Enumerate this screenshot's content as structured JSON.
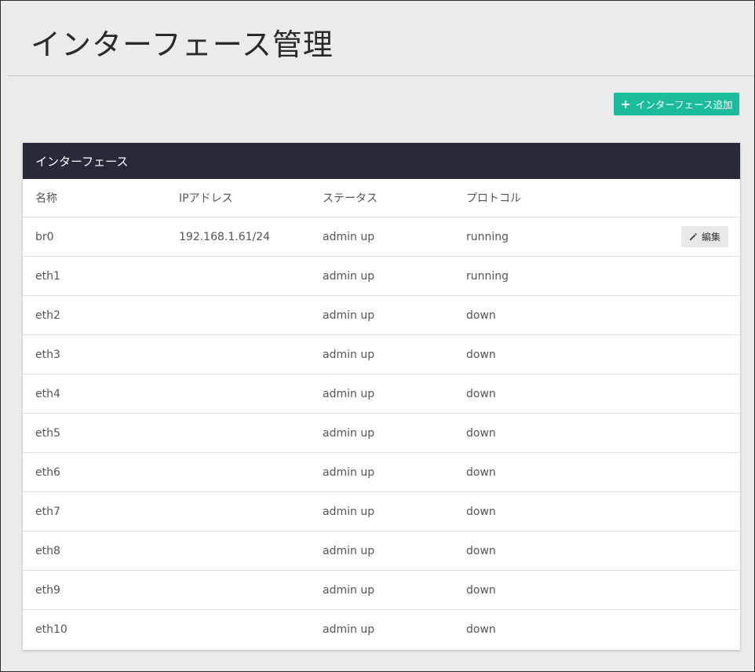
{
  "page": {
    "title": "インターフェース管理"
  },
  "toolbar": {
    "add_icon": "plus-icon",
    "add_label": "インターフェース追加"
  },
  "card": {
    "title": "インターフェース"
  },
  "table": {
    "columns": [
      "名称",
      "IPアドレス",
      "ステータス",
      "プロトコル"
    ],
    "edit_label": "編集",
    "edit_icon": "pencil-icon",
    "rows": [
      {
        "name": "br0",
        "ip": "192.168.1.61/24",
        "status": "admin up",
        "protocol": "running",
        "editable": true
      },
      {
        "name": "eth1",
        "ip": "",
        "status": "admin up",
        "protocol": "running",
        "editable": false
      },
      {
        "name": "eth2",
        "ip": "",
        "status": "admin up",
        "protocol": "down",
        "editable": false
      },
      {
        "name": "eth3",
        "ip": "",
        "status": "admin up",
        "protocol": "down",
        "editable": false
      },
      {
        "name": "eth4",
        "ip": "",
        "status": "admin up",
        "protocol": "down",
        "editable": false
      },
      {
        "name": "eth5",
        "ip": "",
        "status": "admin up",
        "protocol": "down",
        "editable": false
      },
      {
        "name": "eth6",
        "ip": "",
        "status": "admin up",
        "protocol": "down",
        "editable": false
      },
      {
        "name": "eth7",
        "ip": "",
        "status": "admin up",
        "protocol": "down",
        "editable": false
      },
      {
        "name": "eth8",
        "ip": "",
        "status": "admin up",
        "protocol": "down",
        "editable": false
      },
      {
        "name": "eth9",
        "ip": "",
        "status": "admin up",
        "protocol": "down",
        "editable": false
      },
      {
        "name": "eth10",
        "ip": "",
        "status": "admin up",
        "protocol": "down",
        "editable": false
      }
    ]
  },
  "colors": {
    "accent": "#1abc9c",
    "header_bg": "#282a3a",
    "page_bg": "#ebebeb"
  }
}
